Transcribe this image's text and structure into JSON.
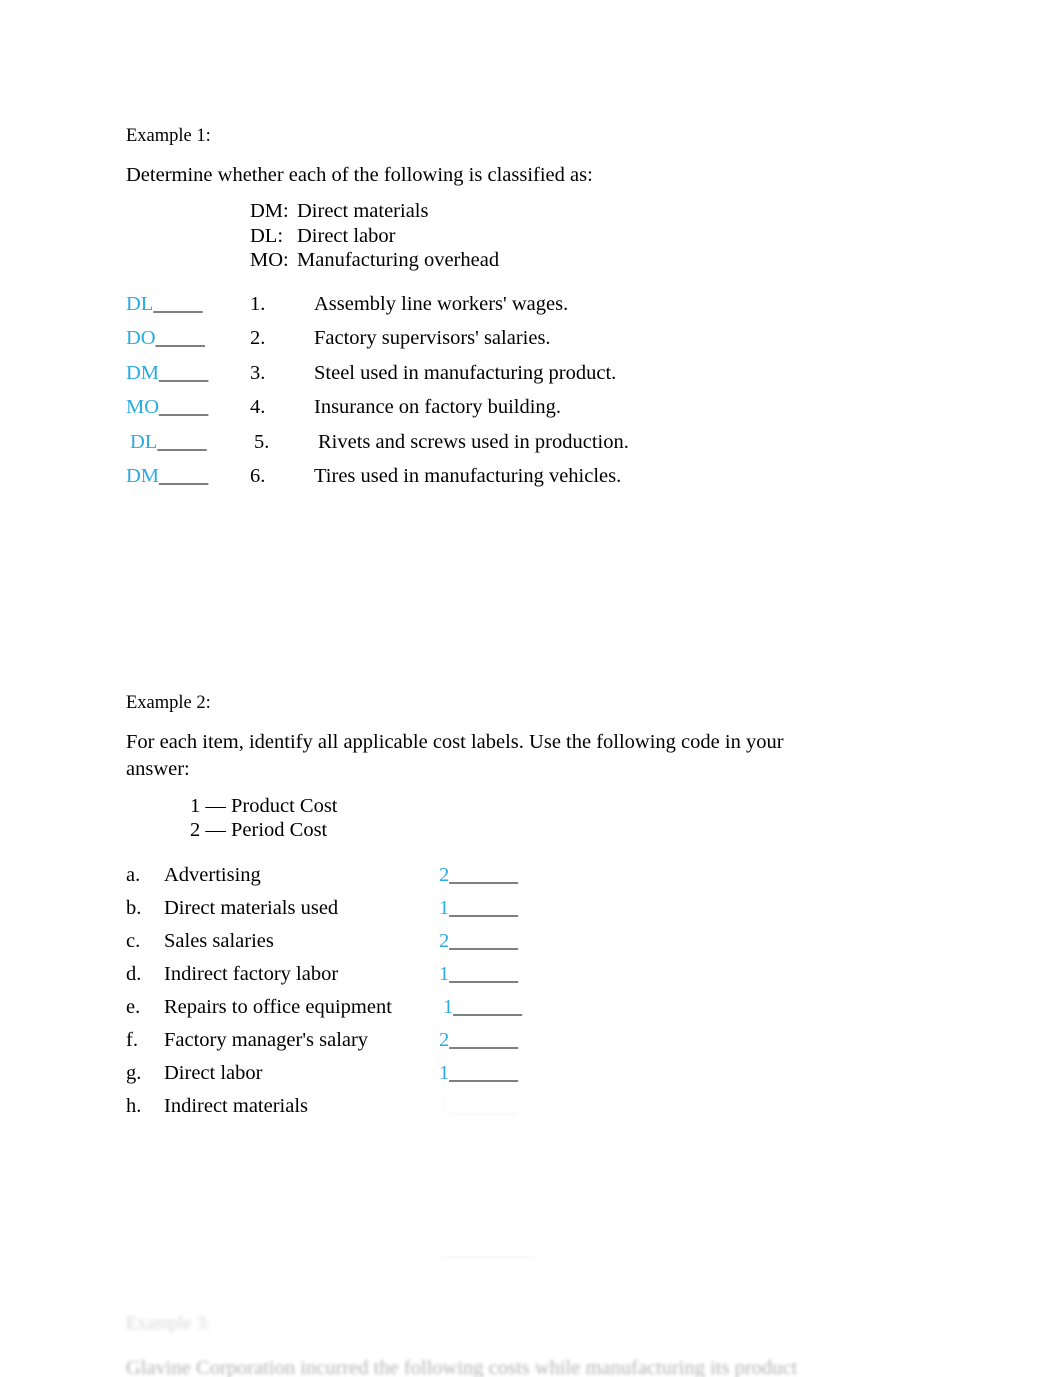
{
  "document": {
    "accent_color": "#29abe2",
    "text_color": "#000000",
    "background_color": "#ffffff",
    "blank_rule": "______"
  },
  "example1": {
    "label": "Example 1:",
    "instruction": "Determine whether each of the following is classified as:",
    "legend": [
      {
        "code": "DM:",
        "text": "Direct materials"
      },
      {
        "code": "DL:",
        "text": "Direct labor"
      },
      {
        "code": "MO:",
        "text": "Manufacturing overhead"
      }
    ],
    "items": [
      {
        "answer": "DL",
        "blank": "_____",
        "number": "1.",
        "description": "Assembly line workers' wages."
      },
      {
        "answer": "DO",
        "blank": "_____",
        "number": "2.",
        "description": "Factory supervisors' salaries."
      },
      {
        "answer": "DM",
        "blank": "_____",
        "number": "3.",
        "description": "Steel used in manufacturing product."
      },
      {
        "answer": "MO",
        "blank": "_____",
        "number": "4.",
        "description": "Insurance on factory building."
      },
      {
        "answer": "DL",
        "blank": "_____",
        "number": "5.",
        "description": "Rivets and screws used in production."
      },
      {
        "answer": "DM",
        "blank": "_____",
        "number": "6.",
        "description": "Tires used in manufacturing vehicles."
      }
    ]
  },
  "example2": {
    "label": "Example 2:",
    "instruction": "For each item, identify all applicable cost labels. Use the following code in your answer:",
    "legend": [
      "1 — Product Cost",
      "2 — Period Cost"
    ],
    "items": [
      {
        "letter": "a.",
        "item": "Advertising",
        "answer": "2",
        "blank": "_______"
      },
      {
        "letter": "b.",
        "item": "Direct materials used",
        "answer": "1",
        "blank": "_______"
      },
      {
        "letter": "c.",
        "item": "Sales salaries",
        "answer": "2",
        "blank": "_______"
      },
      {
        "letter": "d.",
        "item": "Indirect factory labor",
        "answer": "1",
        "blank": "_______"
      },
      {
        "letter": "e.",
        "item": "Repairs to office equipment",
        "answer": "1",
        "blank": "_______"
      },
      {
        "letter": "f.",
        "item": "Factory manager's salary",
        "answer": "2",
        "blank": "_______"
      },
      {
        "letter": "g.",
        "item": "Direct labor",
        "answer": "1",
        "blank": "_______"
      },
      {
        "letter": "h.",
        "item": "Indirect materials",
        "answer": "1",
        "blank": "_______"
      }
    ]
  },
  "example3": {
    "label": "Example 3:",
    "instruction": "Glavine Corporation incurred the following costs while manufacturing its product"
  }
}
